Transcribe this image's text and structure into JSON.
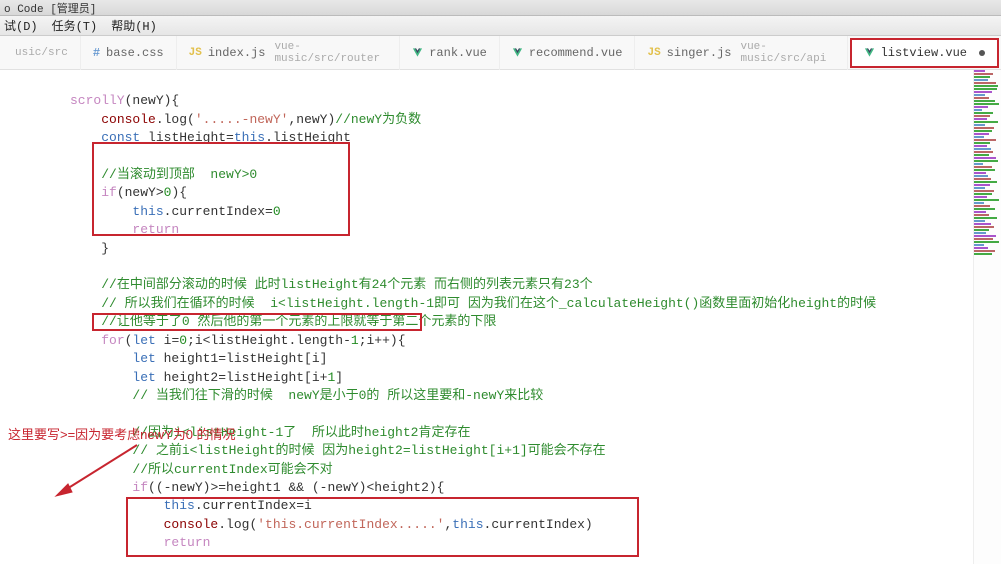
{
  "titlebar": "o Code [管理员]",
  "menu": {
    "shi": "试(D)",
    "renwu": "任务(T)",
    "bangzhu": "帮助(H)"
  },
  "tabs": [
    {
      "name": "usicsrc",
      "label": "",
      "subpath": "usic/src",
      "iconType": "none"
    },
    {
      "name": "basecss",
      "label": "base.css",
      "subpath": "",
      "iconType": "hash"
    },
    {
      "name": "indexjs",
      "label": "index.js",
      "subpath": "vue-music/src/router",
      "iconType": "js"
    },
    {
      "name": "rankvue",
      "label": "rank.vue",
      "subpath": "",
      "iconType": "vue"
    },
    {
      "name": "recommendvue",
      "label": "recommend.vue",
      "subpath": "",
      "iconType": "vue"
    },
    {
      "name": "singerjs",
      "label": "singer.js",
      "subpath": "vue-music/src/api",
      "iconType": "js"
    },
    {
      "name": "listviewvue",
      "label": "listview.vue",
      "subpath": "",
      "iconType": "vue",
      "active": true,
      "dirty": true
    }
  ],
  "code": {
    "l1": {
      "a": "scrollY",
      "b": "(newY){"
    },
    "l2": {
      "a": "console",
      "b": ".log(",
      "c": "'.....-newY'",
      "d": ",newY)",
      "e": "//newY为负数"
    },
    "l3": {
      "a": "const",
      "b": " listHeight=",
      "c": "this",
      "d": ".listHeight"
    },
    "l5": {
      "a": "//当滚动到顶部  newY>0"
    },
    "l6": {
      "a": "if",
      "b": "(newY>",
      "c": "0",
      "d": "){"
    },
    "l7": {
      "a": "this",
      "b": ".currentIndex=",
      "c": "0"
    },
    "l8": {
      "a": "return"
    },
    "l9": {
      "a": "}"
    },
    "l11": {
      "a": "//在中间部分滚动的时候 此时listHeight有24个元素 而右侧的列表元素只有23个"
    },
    "l12": {
      "a": "// 所以我们在循环的时候  i<listHeight.length-1即可 因为我们在这个_calculateHeight()函数里面初始化height的时候"
    },
    "l13": {
      "a": "//让他等于了0 然后他的第一个元素的上限就等于第二个元素的下限"
    },
    "l14": {
      "a": "for",
      "b": "(",
      "c": "let",
      "d": " i=",
      "e": "0",
      "f": ";i<listHeight.length-",
      "g": "1",
      "h": ";i++){"
    },
    "l15": {
      "a": "let",
      "b": " height1=listHeight[i]"
    },
    "l16": {
      "a": "let",
      "b": " height2=listHeight[i+",
      "c": "1",
      "d": "]"
    },
    "l17": {
      "a": "// 当我们往下滑的时候  newY是小于0的 所以这里要和-newY来比较"
    },
    "l19": {
      "a": "//因为i<listHeight-1了  所以此时height2肯定存在"
    },
    "l20": {
      "a": "// 之前i<listHeight的时候 因为height2=listHeight[i+1]可能会不存在"
    },
    "l21": {
      "a": "//所以currentIndex可能会不对"
    },
    "l22": {
      "a": "if",
      "b": "((-newY)>=height1 && (-newY)<height2){"
    },
    "l23": {
      "a": "this",
      "b": ".currentIndex=i"
    },
    "l24": {
      "a": "console",
      "b": ".log(",
      "c": "'this.currentIndex.....'",
      "d": ",",
      "e": "this",
      "f": ".currentIndex)"
    },
    "l25": {
      "a": "return"
    }
  },
  "annot": {
    "a1": "这里要写>=因为要考虑newY为0 的情况"
  }
}
